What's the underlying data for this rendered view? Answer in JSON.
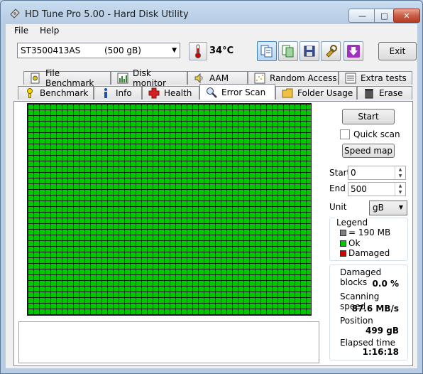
{
  "window": {
    "title": "HD Tune Pro 5.00 - Hard Disk Utility",
    "caption_min": "—",
    "caption_max": "□",
    "caption_close": "✕"
  },
  "menu": {
    "file": "File",
    "help": "Help"
  },
  "toolbar": {
    "drive_name": "ST3500413AS",
    "drive_size": "(500 gB)",
    "temperature": "34°C",
    "exit_label": "Exit"
  },
  "tabs_top": [
    {
      "label": "File Benchmark",
      "icon": "file-benchmark-icon"
    },
    {
      "label": "Disk monitor",
      "icon": "disk-monitor-icon"
    },
    {
      "label": "AAM",
      "icon": "speaker-icon"
    },
    {
      "label": "Random Access",
      "icon": "random-access-icon"
    },
    {
      "label": "Extra tests",
      "icon": "extra-tests-icon"
    }
  ],
  "tabs_bottom": [
    {
      "label": "Benchmark",
      "icon": "benchmark-icon"
    },
    {
      "label": "Info",
      "icon": "info-icon"
    },
    {
      "label": "Health",
      "icon": "health-cross-icon"
    },
    {
      "label": "Error Scan",
      "icon": "magnifier-icon",
      "selected": true
    },
    {
      "label": "Folder Usage",
      "icon": "folder-icon"
    },
    {
      "label": "Erase",
      "icon": "trash-icon"
    }
  ],
  "controls": {
    "start_button": "Start",
    "quick_scan": "Quick scan",
    "speed_map": "Speed map",
    "start_label": "Start",
    "start_value": "0",
    "end_label": "End",
    "end_value": "500",
    "unit_label": "Unit",
    "unit_value": "gB"
  },
  "legend": {
    "title": "Legend",
    "block_size": "= 190 MB",
    "ok": "Ok",
    "damaged": "Damaged"
  },
  "stats": {
    "damaged_blocks_label": "Damaged blocks",
    "damaged_blocks_value": "0.0 %",
    "scanning_speed_label": "Scanning speed",
    "scanning_speed_value": "87.6 MB/s",
    "position_label": "Position",
    "position_value": "499 gB",
    "elapsed_time_label": "Elapsed time",
    "elapsed_time_value": "1:16:18"
  },
  "colors": {
    "ok": "#00c800",
    "damaged": "#d40000",
    "block": "#808080",
    "window_frame": "#b8cde4"
  }
}
